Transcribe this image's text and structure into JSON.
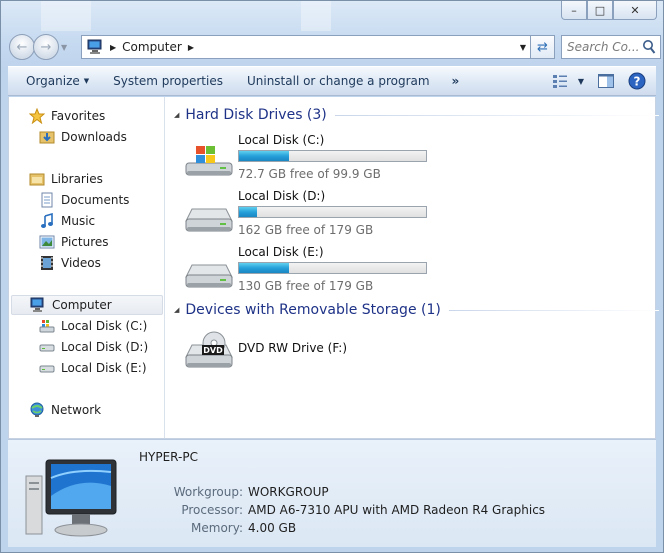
{
  "window": {
    "caption": {
      "minimize": "–",
      "maximize": "□",
      "close": "✕"
    }
  },
  "navbar": {
    "breadcrumb": "Computer",
    "search_placeholder": "Search Co..."
  },
  "toolbar": {
    "organize": "Organize",
    "system_properties": "System properties",
    "uninstall": "Uninstall or change a program",
    "more": "»"
  },
  "sidebar": {
    "favorites": {
      "label": "Favorites",
      "items": [
        {
          "label": "Downloads",
          "icon": "downloads-folder-icon"
        }
      ]
    },
    "libraries": {
      "label": "Libraries",
      "items": [
        {
          "label": "Documents",
          "icon": "documents-icon"
        },
        {
          "label": "Music",
          "icon": "music-icon"
        },
        {
          "label": "Pictures",
          "icon": "pictures-icon"
        },
        {
          "label": "Videos",
          "icon": "videos-icon"
        }
      ]
    },
    "computer": {
      "label": "Computer",
      "items": [
        {
          "label": "Local Disk (C:)",
          "icon": "system-drive-icon"
        },
        {
          "label": "Local Disk (D:)",
          "icon": "drive-icon"
        },
        {
          "label": "Local Disk (E:)",
          "icon": "drive-icon"
        }
      ]
    },
    "network": {
      "label": "Network"
    }
  },
  "main": {
    "groups": [
      {
        "title": "Hard Disk Drives (3)",
        "drives": [
          {
            "name": "Local Disk (C:)",
            "free": "72.7 GB free of 99.9 GB",
            "used_fraction": 0.27,
            "icon": "windows-drive-icon"
          },
          {
            "name": "Local Disk (D:)",
            "free": "162 GB free of 179 GB",
            "used_fraction": 0.095,
            "icon": "hard-drive-icon"
          },
          {
            "name": "Local Disk (E:)",
            "free": "130 GB free of 179 GB",
            "used_fraction": 0.27,
            "icon": "hard-drive-icon"
          }
        ]
      },
      {
        "title": "Devices with Removable Storage (1)",
        "drives": [
          {
            "name": "DVD RW Drive (F:)",
            "icon": "dvd-drive-icon",
            "badge": "DVD"
          }
        ]
      }
    ]
  },
  "details": {
    "pc_name": "HYPER-PC",
    "workgroup_label": "Workgroup:",
    "workgroup": "WORKGROUP",
    "processor_label": "Processor:",
    "processor": "AMD A6-7310 APU with AMD Radeon R4 Graphics",
    "memory_label": "Memory:",
    "memory": "4.00 GB"
  },
  "colors": {
    "accent": "#1e3287",
    "bar": "#26a0da",
    "toolbar_text": "#1e395b"
  }
}
